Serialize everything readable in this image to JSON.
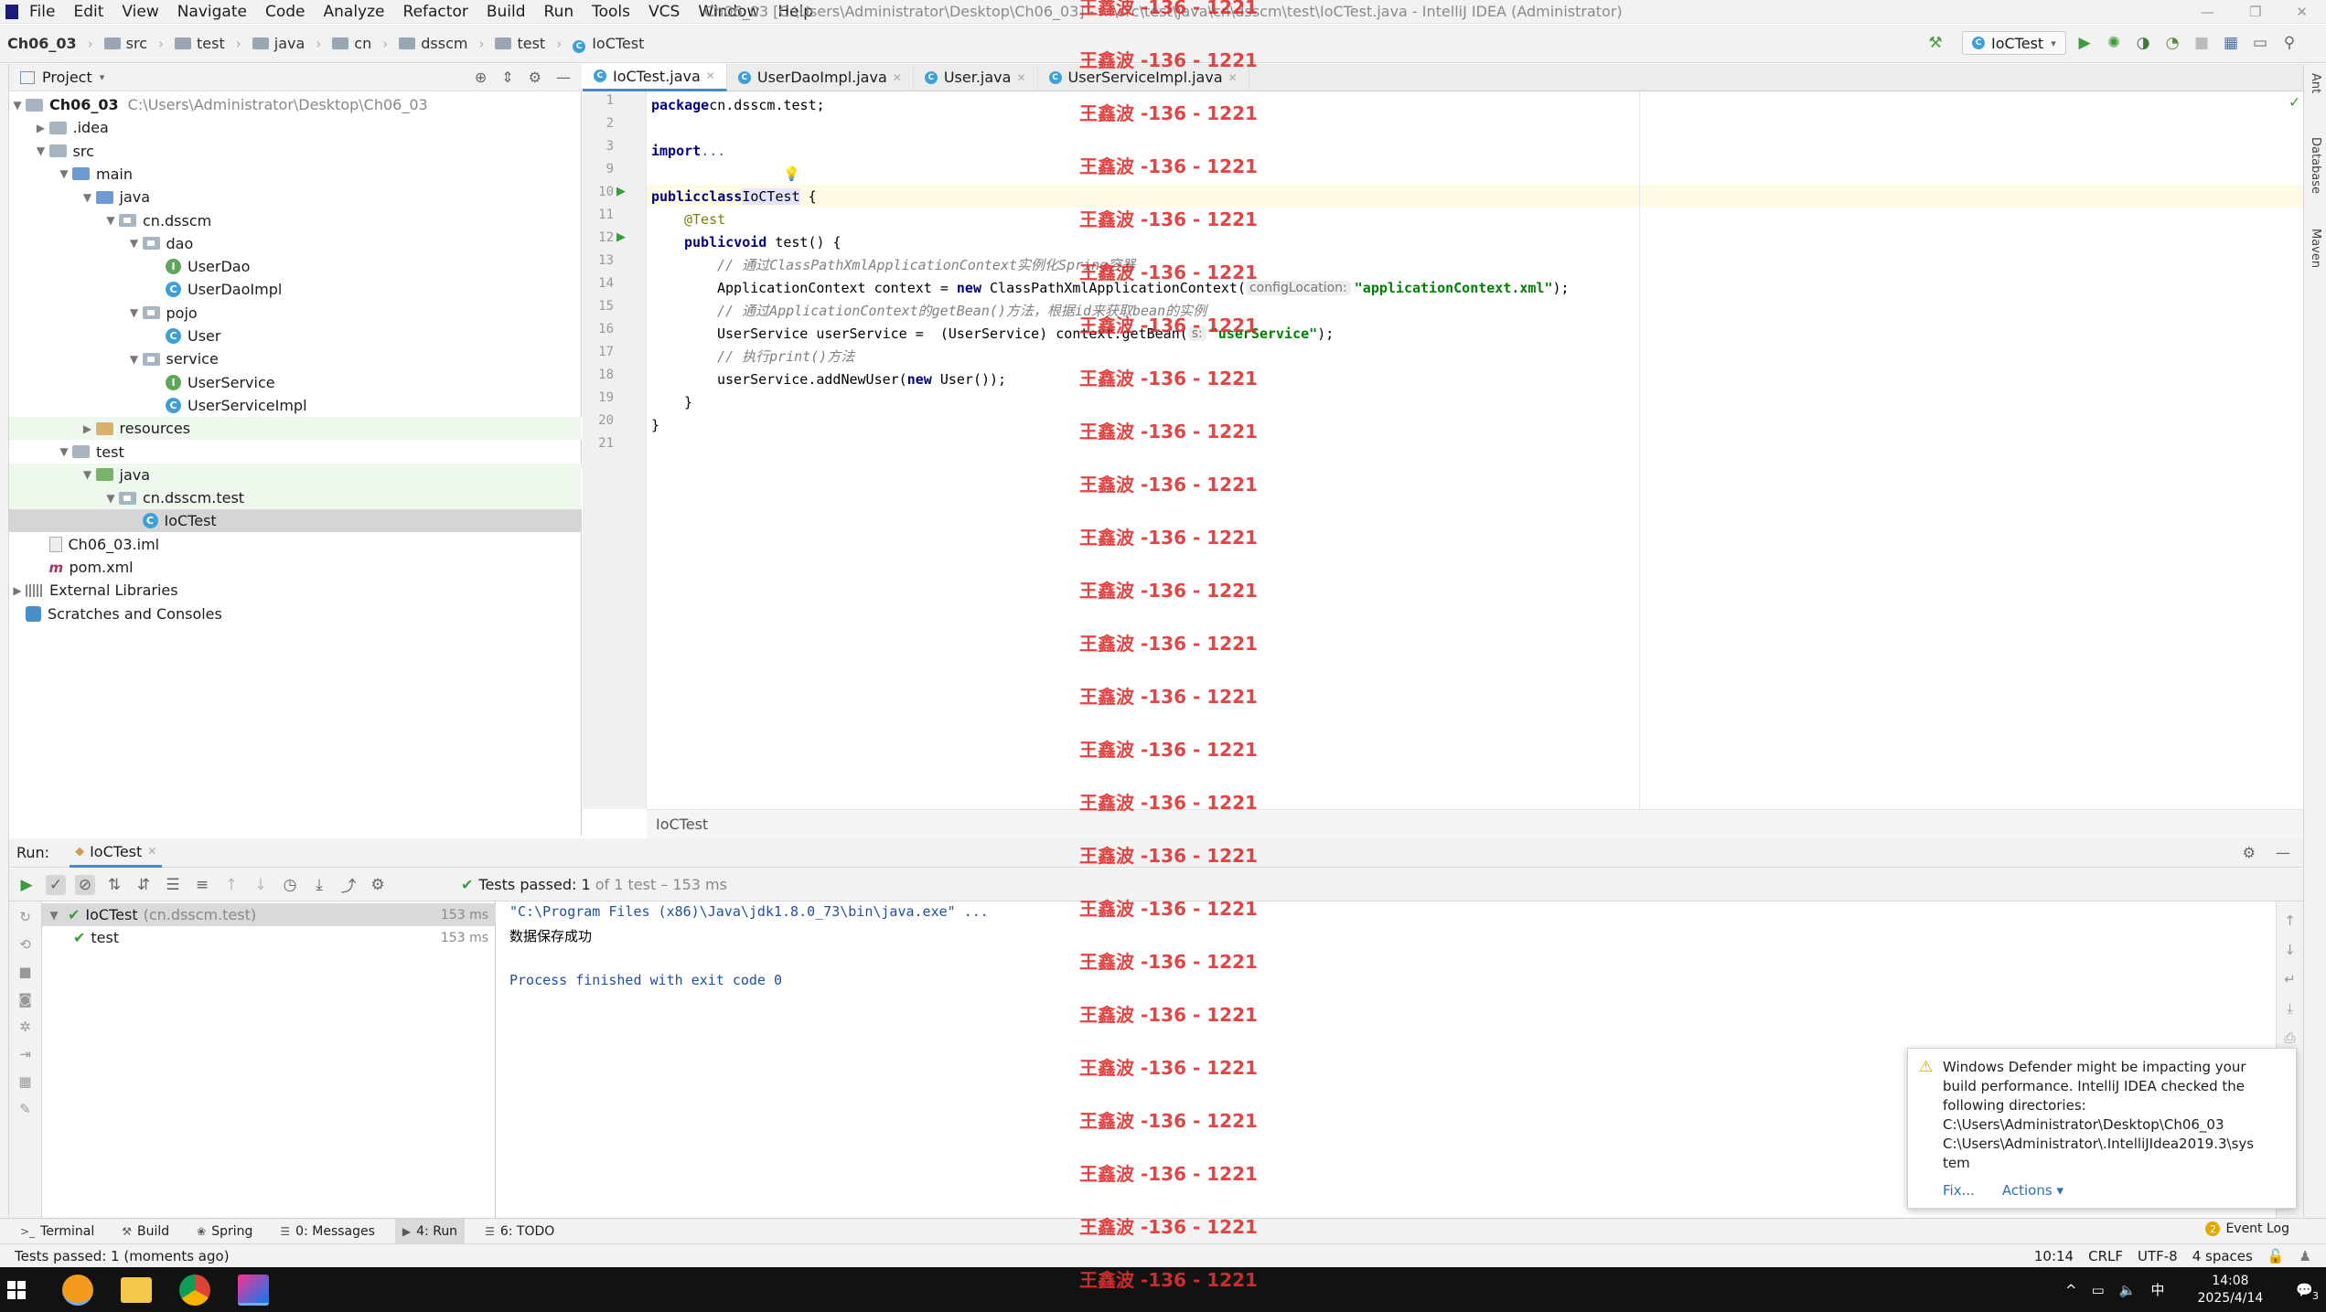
{
  "menu": [
    "File",
    "Edit",
    "View",
    "Navigate",
    "Code",
    "Analyze",
    "Refactor",
    "Build",
    "Run",
    "Tools",
    "VCS",
    "Window",
    "Help"
  ],
  "window_title": "Ch06_03 [C:\\Users\\Administrator\\Desktop\\Ch06_03] - ...\\src\\test\\java\\cn\\dsscm\\test\\IoCTest.java - IntelliJ IDEA (Administrator)",
  "breadcrumbs": [
    "Ch06_03",
    "src",
    "test",
    "java",
    "cn",
    "dsscm",
    "test",
    "IoCTest"
  ],
  "run_config": "IoCTest",
  "project": {
    "header": "Project",
    "root_name": "Ch06_03",
    "root_path": "C:\\Users\\Administrator\\Desktop\\Ch06_03",
    "nodes": [
      {
        "label": ".idea",
        "icon": "folder-icon"
      },
      {
        "label": "src",
        "icon": "folder-icon"
      },
      {
        "label": "main",
        "icon": "folder-icon"
      },
      {
        "label": "java",
        "icon": "folder-icon"
      },
      {
        "label": "cn.dsscm",
        "icon": "package-icon"
      },
      {
        "label": "dao",
        "icon": "package-icon"
      },
      {
        "label": "UserDao",
        "icon": "interface-icon"
      },
      {
        "label": "UserDaoImpl",
        "icon": "class-icon"
      },
      {
        "label": "pojo",
        "icon": "package-icon"
      },
      {
        "label": "User",
        "icon": "class-icon"
      },
      {
        "label": "service",
        "icon": "package-icon"
      },
      {
        "label": "UserService",
        "icon": "interface-icon"
      },
      {
        "label": "UserServiceImpl",
        "icon": "class-icon"
      },
      {
        "label": "resources",
        "icon": "folder-icon"
      },
      {
        "label": "test",
        "icon": "folder-icon"
      },
      {
        "label": "java",
        "icon": "folder-icon"
      },
      {
        "label": "cn.dsscm.test",
        "icon": "package-icon"
      },
      {
        "label": "IoCTest",
        "icon": "class-icon"
      },
      {
        "label": "Ch06_03.iml",
        "icon": "file-icon"
      },
      {
        "label": "pom.xml",
        "icon": "maven-icon"
      },
      {
        "label": "External Libraries",
        "icon": "library-icon"
      },
      {
        "label": "Scratches and Consoles",
        "icon": "scratch-icon"
      }
    ]
  },
  "editor_tabs": [
    "IoCTest.java",
    "UserDaoImpl.java",
    "User.java",
    "UserServiceImpl.java"
  ],
  "line_numbers": [
    "1",
    "2",
    "3",
    "9",
    "10",
    "11",
    "12",
    "13",
    "14",
    "15",
    "16",
    "17",
    "18",
    "19",
    "20",
    "21"
  ],
  "code": {
    "l1": "cn.dsscm.test;",
    "kw_package": "package",
    "kw_import": "import",
    "import_dots": "...",
    "kw_public": "public",
    "kw_class": "class",
    "class_name": "IoCTest",
    "brace_open": " {",
    "annotation": "@Test",
    "kw_void": "void",
    "method_sig": " test() {",
    "c1": "// 通过ClassPathXmlApplicationContext实例化Spring容器",
    "l14a": "ApplicationContext context = ",
    "kw_new": "new",
    "l14b": " ClassPathXmlApplicationContext(",
    "hint1": "configLocation:",
    "str1": "\"applicationContext.xml\"",
    "end1": ");",
    "c2": "// 通过ApplicationContext的getBean()方法，根据id来获取bean的实例",
    "l16a": "UserService userService =  (UserService) context.getBean(",
    "hint2": "s:",
    "str2": "\"userService\"",
    "end2": ");",
    "c3": "// 执行print()方法",
    "l18a": "userService.addNewUser(",
    "l18b": " User());",
    "close_inner": "}",
    "close_outer": "}"
  },
  "editor_breadcrumb": "IoCTest",
  "run": {
    "label": "Run:",
    "tab": "IoCTest",
    "status_prefix": "Tests passed:",
    "status_count": "1",
    "status_rest": "of 1 test – 153 ms",
    "tree": [
      {
        "label": "IoCTest",
        "sub": "(cn.dsscm.test)",
        "time": "153 ms"
      },
      {
        "label": "test",
        "sub": "",
        "time": "153 ms"
      }
    ],
    "console": [
      "\"C:\\Program Files (x86)\\Java\\jdk1.8.0_73\\bin\\java.exe\" ...",
      "数据保存成功",
      "",
      "Process finished with exit code 0"
    ]
  },
  "right_strip": [
    "Ant",
    "Database",
    "Maven"
  ],
  "bottom_tabs": [
    "Terminal",
    "Build",
    "Spring",
    "0: Messages",
    "4: Run",
    "6: TODO"
  ],
  "event_log": "Event Log",
  "status": {
    "message": "Tests passed: 1 (moments ago)",
    "position": "10:14",
    "line_sep": "CRLF",
    "encoding": "UTF-8",
    "indent": "4 spaces"
  },
  "notification": {
    "text": [
      "Windows Defender might be impacting your",
      "build performance. IntelliJ IDEA checked the",
      "following directories:",
      "C:\\Users\\Administrator\\Desktop\\Ch06_03",
      "C:\\Users\\Administrator\\.IntelliJIdea2019.3\\sys",
      "tem"
    ],
    "fix": "Fix...",
    "actions": "Actions ▾"
  },
  "taskbar": {
    "time": "14:08",
    "date": "2025/4/14",
    "ime": "中",
    "notif_count": "3"
  },
  "watermark": "王鑫波 -136 - 1221",
  "colors": {
    "accent": "#4a88c7",
    "pass_green": "#3d9b3d",
    "watermark": "#e03030"
  }
}
